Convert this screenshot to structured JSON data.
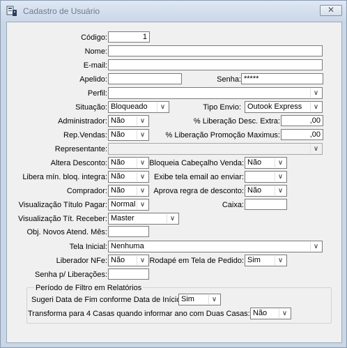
{
  "window": {
    "title": "Cadastro de Usuário",
    "close_glyph": "✕"
  },
  "fields": {
    "codigo": {
      "label": "Código:",
      "value": "1"
    },
    "nome": {
      "label": "Nome:",
      "value": ""
    },
    "email": {
      "label": "E-mail:",
      "value": ""
    },
    "apelido": {
      "label": "Apelido:",
      "value": ""
    },
    "senha": {
      "label": "Senha:",
      "value": "*****"
    },
    "perfil": {
      "label": "Perfil:",
      "value": ""
    },
    "situacao": {
      "label": "Situação:",
      "value": "Bloqueado"
    },
    "tipo_envio": {
      "label": "Tipo Envio:",
      "value": "Outook Express"
    },
    "administrador": {
      "label": "Administrador:",
      "value": "Não"
    },
    "lib_desc_extra": {
      "label": "% Liberação Desc. Extra:",
      "value": ",00"
    },
    "rep_vendas": {
      "label": "Rep.Vendas:",
      "value": "Não"
    },
    "lib_promo_max": {
      "label": "% Liberação Promoção Maximus:",
      "value": ",00"
    },
    "representante": {
      "label": "Representante:",
      "value": ""
    },
    "altera_desconto": {
      "label": "Altera Desconto:",
      "value": "Não"
    },
    "bloqueia_cabecalho": {
      "label": "Bloqueia Cabeçalho Venda:",
      "value": "Não"
    },
    "libera_min_bloq": {
      "label": "Libera mín. bloq. integra:",
      "value": "Não"
    },
    "exibe_tela_email": {
      "label": "Exibe tela email ao enviar:",
      "value": ""
    },
    "comprador": {
      "label": "Comprador:",
      "value": "Não"
    },
    "aprova_regra": {
      "label": "Aprova regra de desconto:",
      "value": "Não"
    },
    "vis_titulo_pagar": {
      "label": "Visualização Título Pagar:",
      "value": "Normal"
    },
    "caixa": {
      "label": "Caixa:",
      "value": ""
    },
    "vis_tit_receber": {
      "label": "Visualização Tít. Receber:",
      "value": "Master"
    },
    "obj_novos_atend": {
      "label": "Obj. Novos Atend. Mês:",
      "value": ""
    },
    "tela_inicial": {
      "label": "Tela Inicial:",
      "value": "Nenhuma"
    },
    "liberador_nfe": {
      "label": "Liberador NFe:",
      "value": "Não"
    },
    "rodape_tela_pedido": {
      "label": "Rodapé em Tela de Pedido:",
      "value": "Sim"
    },
    "senha_liberacoes": {
      "label": "Senha p/ Liberações:",
      "value": ""
    }
  },
  "periodo_group": {
    "title": "Período de Filtro em Relatórios",
    "sugeri_data_fim": {
      "label": "Sugeri Data de Fim conforme Data de Início:",
      "value": "Sim"
    },
    "transforma_4_casas": {
      "label": "Transforma para 4 Casas quando informar ano com Duas Casas:",
      "value": "Não"
    }
  },
  "icons": {
    "dropdown": "chevron-down-icon",
    "app": "app-window-icon",
    "close": "close-icon"
  },
  "colors": {
    "titlebar_top": "#dfe8f3",
    "titlebar_bottom": "#cad7e8",
    "client_bg": "#f0f0f0",
    "title_text": "#6b7c92"
  }
}
